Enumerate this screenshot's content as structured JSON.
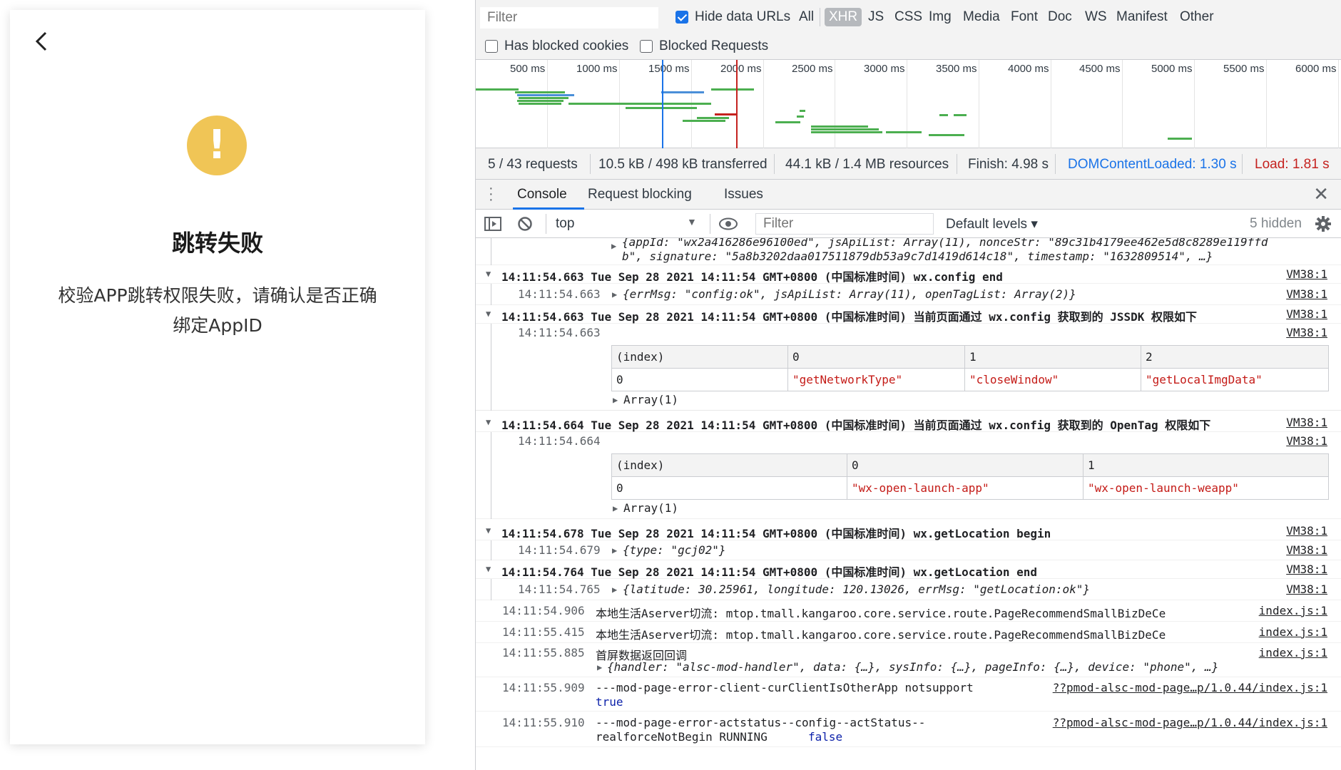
{
  "phone": {
    "back_icon": "chevron-left-icon",
    "warn_symbol": "!",
    "title": "跳转失败",
    "desc_line1": "校验APP跳转权限失败，请确认是否正确",
    "desc_line2": "绑定AppID",
    "warn_color": "#f0c556"
  },
  "network": {
    "filter_placeholder": "Filter",
    "hide_data_urls": "Hide data URLs",
    "types": [
      "All",
      "XHR",
      "JS",
      "CSS",
      "Img",
      "Media",
      "Font",
      "Doc",
      "WS",
      "Manifest",
      "Other"
    ],
    "active_type": "XHR",
    "has_blocked_cookies": "Has blocked cookies",
    "blocked_requests": "Blocked Requests",
    "timeline_ticks": [
      "500 ms",
      "1000 ms",
      "1500 ms",
      "2000 ms",
      "2500 ms",
      "3000 ms",
      "3500 ms",
      "4000 ms",
      "4500 ms",
      "5000 ms",
      "5500 ms",
      "6000 ms"
    ],
    "summary": {
      "requests": "5 / 43 requests",
      "transferred": "10.5 kB / 498 kB transferred",
      "resources": "44.1 kB / 1.4 MB resources",
      "finish": "Finish: 4.98 s",
      "dcl": "DOMContentLoaded: 1.30 s",
      "load": "Load: 1.81 s"
    },
    "colors": {
      "dcl": "#1a73e8",
      "load": "#c5221f",
      "bar_green": "#4caf50",
      "bar_blue": "#4a8fd8"
    }
  },
  "console": {
    "tabs": [
      "Console",
      "Request blocking",
      "Issues"
    ],
    "context": "top",
    "filter_placeholder": "Filter",
    "levels": "Default levels ▾",
    "hidden": "5 hidden"
  },
  "log": {
    "r0_a": "{appId: \"wx2a416286e96100ed\", jsApiList: Array(11), nonceStr: \"89c31b4179ee462e5d8c8289e119ffd",
    "r0_b": "b\", signature: \"5a8b3202daa017511879db53a9c7d1419d614c18\", timestamp: \"1632809514\", …}",
    "r1_head": "14:11:54.663 Tue Sep 28 2021 14:11:54 GMT+0800 (中国标准时间) wx.config end",
    "r1_ts": "14:11:54.663",
    "r1_obj": "{errMsg: \"config:ok\", jsApiList: Array(11), openTagList: Array(2)}",
    "r2_head": "14:11:54.663 Tue Sep 28 2021 14:11:54 GMT+0800 (中国标准时间) 当前页面通过 wx.config 获取到的 JSSDK 权限如下",
    "r2_ts": "14:11:54.663",
    "t1_head": [
      "(index)",
      "0",
      "1",
      "2"
    ],
    "t1_row": [
      "0",
      "\"getNetworkType\"",
      "\"closeWindow\"",
      "\"getLocalImgData\""
    ],
    "arr1": "Array(1)",
    "r3_head": "14:11:54.664 Tue Sep 28 2021 14:11:54 GMT+0800 (中国标准时间) 当前页面通过 wx.config 获取到的 OpenTag 权限如下",
    "r3_ts": "14:11:54.664",
    "t2_head": [
      "(index)",
      "0",
      "1"
    ],
    "t2_row": [
      "0",
      "\"wx-open-launch-app\"",
      "\"wx-open-launch-weapp\""
    ],
    "arr2": "Array(1)",
    "r4_head": "14:11:54.678 Tue Sep 28 2021 14:11:54 GMT+0800 (中国标准时间) wx.getLocation begin",
    "r4_ts": "14:11:54.679",
    "r4_obj": "{type: \"gcj02\"}",
    "r5_head": "14:11:54.764 Tue Sep 28 2021 14:11:54 GMT+0800 (中国标准时间) wx.getLocation end",
    "r5_ts": "14:11:54.765",
    "r5_obj": "{latitude: 30.25961, longitude: 120.13026, errMsg: \"getLocation:ok\"}",
    "r6_ts": "14:11:54.906",
    "r6_text": "本地生活Aserver切流:  mtop.tmall.kangaroo.core.service.route.PageRecommendSmallBizDeCe",
    "r7_ts": "14:11:55.415",
    "r7_text": "本地生活Aserver切流:  mtop.tmall.kangaroo.core.service.route.PageRecommendSmallBizDeCe",
    "r8_ts": "14:11:55.885",
    "r8_text": "首屏数据返回回调",
    "r8_obj": "{handler: \"alsc-mod-handler\", data: {…}, sysInfo: {…}, pageInfo: {…}, device: \"phone\", …}",
    "r9_ts": "14:11:55.909",
    "r9_text": "---mod-page-error-client-curClientIsOtherApp notsupport",
    "r9_val": "true",
    "r10_ts": "14:11:55.910",
    "r10_text": "---mod-page-error-actstatus--config--actStatus--",
    "r10_text2": "realforceNotBegin RUNNING",
    "r10_val": "false",
    "src_vm": "VM38:1",
    "src_index": "index.js:1",
    "src_mod": "??pmod-alsc-mod-page…p/1.0.44/index.js:1"
  }
}
